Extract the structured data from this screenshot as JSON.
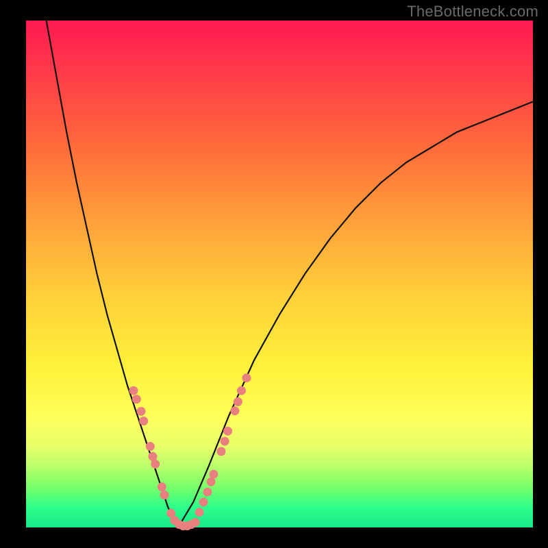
{
  "watermark": "TheBottleneck.com",
  "colors": {
    "frame": "#000000",
    "curve": "#111111",
    "dots": "#e98080",
    "gradient_top": "#ff1a52",
    "gradient_mid": "#ffff5a",
    "gradient_bottom": "#18e88a"
  },
  "chart_data": {
    "type": "line",
    "title": "",
    "xlabel": "",
    "ylabel": "",
    "xlim": [
      0,
      100
    ],
    "ylim": [
      0,
      100
    ],
    "grid": false,
    "description": "Two monotone curves forming a V. Vertex near x≈30, y≈0. Left branch rises steeply to top-left corner (x≈4, y≈100). Right branch rises with decreasing slope toward top-right (x≈100, y≈84). Background gradient encodes y-value: high y = red (bad), low y = green (good). Salmon dots mark sampled points on both branches near the valley.",
    "series": [
      {
        "name": "left_branch",
        "x": [
          4,
          6,
          8,
          10,
          12,
          14,
          16,
          18,
          20,
          22,
          24,
          26,
          28,
          30
        ],
        "y": [
          100,
          89,
          78,
          68,
          59,
          50,
          42,
          35,
          28,
          22,
          16,
          10,
          4,
          0
        ]
      },
      {
        "name": "right_branch",
        "x": [
          30,
          33,
          36,
          40,
          45,
          50,
          55,
          60,
          65,
          70,
          75,
          80,
          85,
          90,
          95,
          100
        ],
        "y": [
          0,
          5,
          12,
          22,
          33,
          42,
          50,
          57,
          63,
          68,
          72,
          75,
          78,
          80,
          82,
          84
        ]
      }
    ],
    "dots_left_branch": [
      {
        "x": 21.2,
        "y": 27.0
      },
      {
        "x": 21.8,
        "y": 25.3
      },
      {
        "x": 22.7,
        "y": 22.9
      },
      {
        "x": 23.2,
        "y": 21.0
      },
      {
        "x": 24.5,
        "y": 16.0
      },
      {
        "x": 25.0,
        "y": 14.0
      },
      {
        "x": 25.5,
        "y": 12.5
      },
      {
        "x": 26.8,
        "y": 8.0
      },
      {
        "x": 27.3,
        "y": 6.4
      },
      {
        "x": 28.6,
        "y": 2.8
      },
      {
        "x": 29.3,
        "y": 1.4
      }
    ],
    "dots_bottom": [
      {
        "x": 30.2,
        "y": 0.6
      },
      {
        "x": 31.0,
        "y": 0.3
      },
      {
        "x": 31.8,
        "y": 0.3
      },
      {
        "x": 32.6,
        "y": 0.6
      },
      {
        "x": 33.4,
        "y": 1.0
      }
    ],
    "dots_right_branch": [
      {
        "x": 34.2,
        "y": 3.0
      },
      {
        "x": 35.0,
        "y": 5.0
      },
      {
        "x": 35.8,
        "y": 7.0
      },
      {
        "x": 36.5,
        "y": 9.0
      },
      {
        "x": 37.0,
        "y": 10.5
      },
      {
        "x": 38.5,
        "y": 15.0
      },
      {
        "x": 39.2,
        "y": 17.0
      },
      {
        "x": 39.8,
        "y": 19.0
      },
      {
        "x": 41.2,
        "y": 23.0
      },
      {
        "x": 41.8,
        "y": 24.8
      },
      {
        "x": 42.5,
        "y": 27.0
      },
      {
        "x": 43.5,
        "y": 29.5
      }
    ]
  }
}
